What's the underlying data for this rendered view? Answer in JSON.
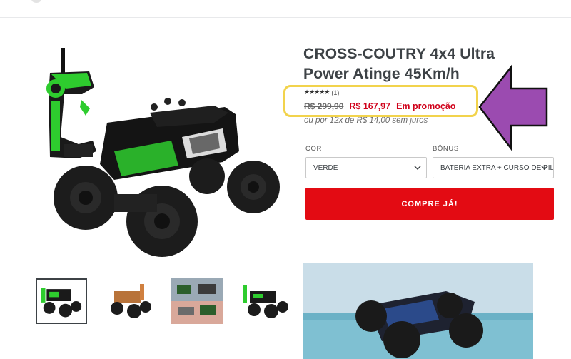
{
  "product": {
    "title": "CROSS-COUTRY 4x4 Ultra Power Atinge 45Km/h",
    "rating": {
      "stars": "★★★★★",
      "count": "(1)",
      "value_out_of_5": 5
    },
    "price": {
      "old": "R$ 299,90",
      "sale": "R$ 167,97",
      "promo_label": "Em promoção"
    },
    "installments": "ou por 12x de R$ 14,00 sem juros"
  },
  "options": {
    "color": {
      "label": "COR",
      "value": "VERDE"
    },
    "bonus": {
      "label": "BÔNUS",
      "value": "BATERIA EXTRA + CURSO DE PILOTAGEM"
    }
  },
  "buy_button": {
    "label": "COMPRE JÁ!"
  },
  "colors": {
    "accent_red": "#e30b13",
    "highlight_yellow": "#f2d34c",
    "arrow_purple": "#9b4bb0",
    "toy_green": "#2ecc2e"
  },
  "icons": {
    "chevron": "chevron-down-icon",
    "star": "star-icon",
    "arrow": "left-arrow-annotation"
  }
}
